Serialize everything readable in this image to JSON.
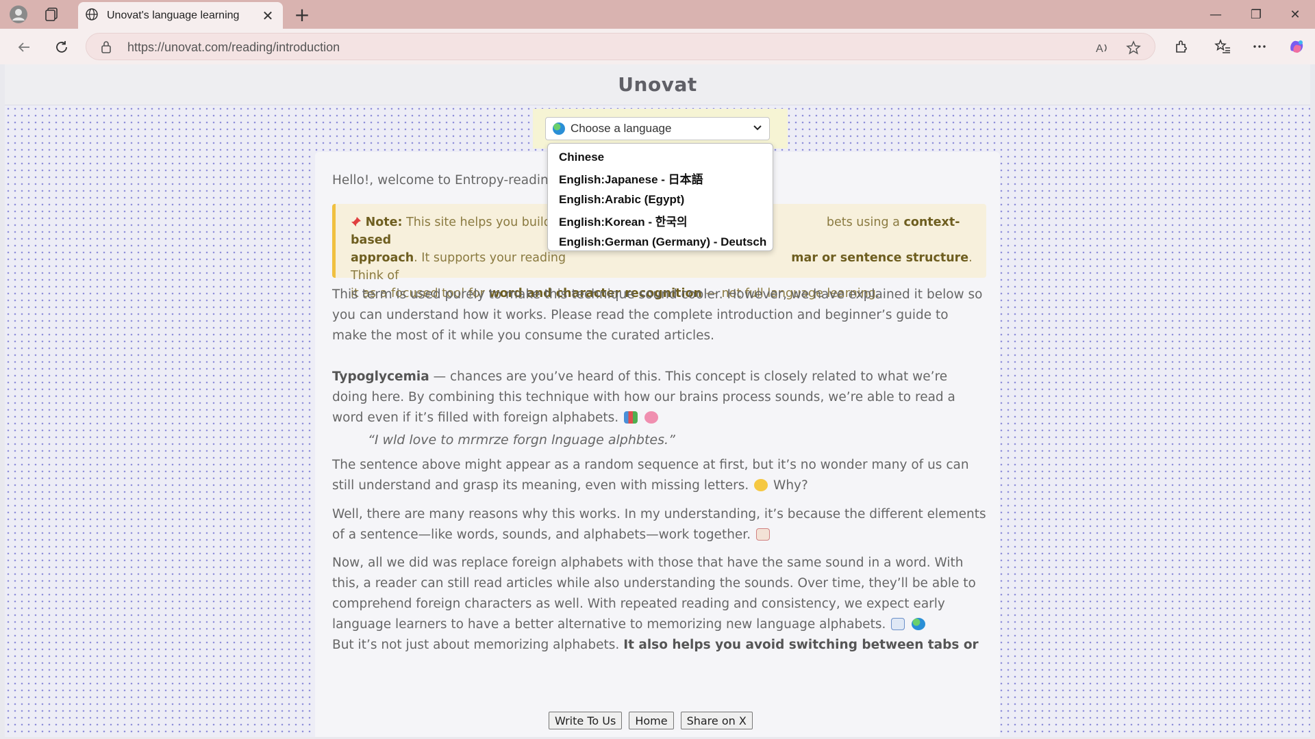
{
  "browser": {
    "tab_title": "Unovat's language learning",
    "tab_close": "✕",
    "new_tab": "+",
    "url": "https://unovat.com/reading/introduction",
    "window_controls": {
      "minimize": "—",
      "restore": "❐",
      "close": "✕"
    },
    "icons": [
      "profile-icon",
      "collections-icon",
      "globe-icon",
      "back-icon",
      "refresh-icon",
      "lock-icon",
      "read-aloud-icon",
      "favorite-star-icon",
      "extensions-icon",
      "favorites-icon",
      "more-icon",
      "copilot-icon"
    ]
  },
  "site": {
    "title": "Unovat"
  },
  "language_select": {
    "label": "Choose a language",
    "options": [
      "Chinese",
      "English:Japanese - 日本語",
      "English:Arabic (Egypt)",
      "English:Korean - 한국의",
      "English:German (Germany) - Deutsch"
    ]
  },
  "article": {
    "greeting": "Hello!, welcome to Entropy-reading!",
    "note": {
      "label": "Note:",
      "text_1": "This site helps you build v",
      "text_2": "bets using a",
      "bold_1": "context-based",
      "bold_2": "approach",
      "text_3": ". It supports your reading",
      "bold_3": "mar or sentence structure",
      "text_4": ". Think of",
      "text_5": "it as a focused tool for",
      "bold_4": "word and character recognition",
      "text_6": "— not full language learning."
    },
    "para_1": "This term is used purely to make this technique sound cooler. However, we have explained it below so you can understand how it works. Please read the complete introduction and beginner’s guide to make the most of it while you consume the curated articles.",
    "para_2_bold": "Typoglycemia",
    "para_2": "— chances are you’ve heard of this. This concept is closely related to what we’re doing here. By combining this technique with how our brains process sounds, we’re able to read a word even if it’s filled with foreign alphabets.",
    "quote": "“I wld love to mrmrze forgn lnguage alphbtes.”",
    "para_3": "The sentence above might appear as a random sequence at first, but it’s no wonder many of us can still understand and grasp its meaning, even with missing letters.",
    "para_3_tail": "Why?",
    "para_4": "Well, there are many reasons why this works. In my understanding, it’s because the different elements of a sentence—like words, sounds, and alphabets—work together.",
    "para_5": "Now, all we did was replace foreign alphabets with those that have the same sound in a word. With this, a reader can still read articles while also understanding the sounds. Over time, they’ll be able to comprehend foreign characters as well. With repeated reading and consistency, we expect early language learners to have a better alternative to memorizing new language alphabets.",
    "para_6": "But it’s not just about memorizing alphabets.",
    "para_6_bold": "It also helps you avoid switching between tabs or"
  },
  "footer": {
    "write": "Write To Us",
    "home": "Home",
    "share": "Share on X"
  },
  "colors": {
    "titlebar": "#d9b3b0",
    "note_border": "#f0c040",
    "dot": "#8f8fd9"
  }
}
